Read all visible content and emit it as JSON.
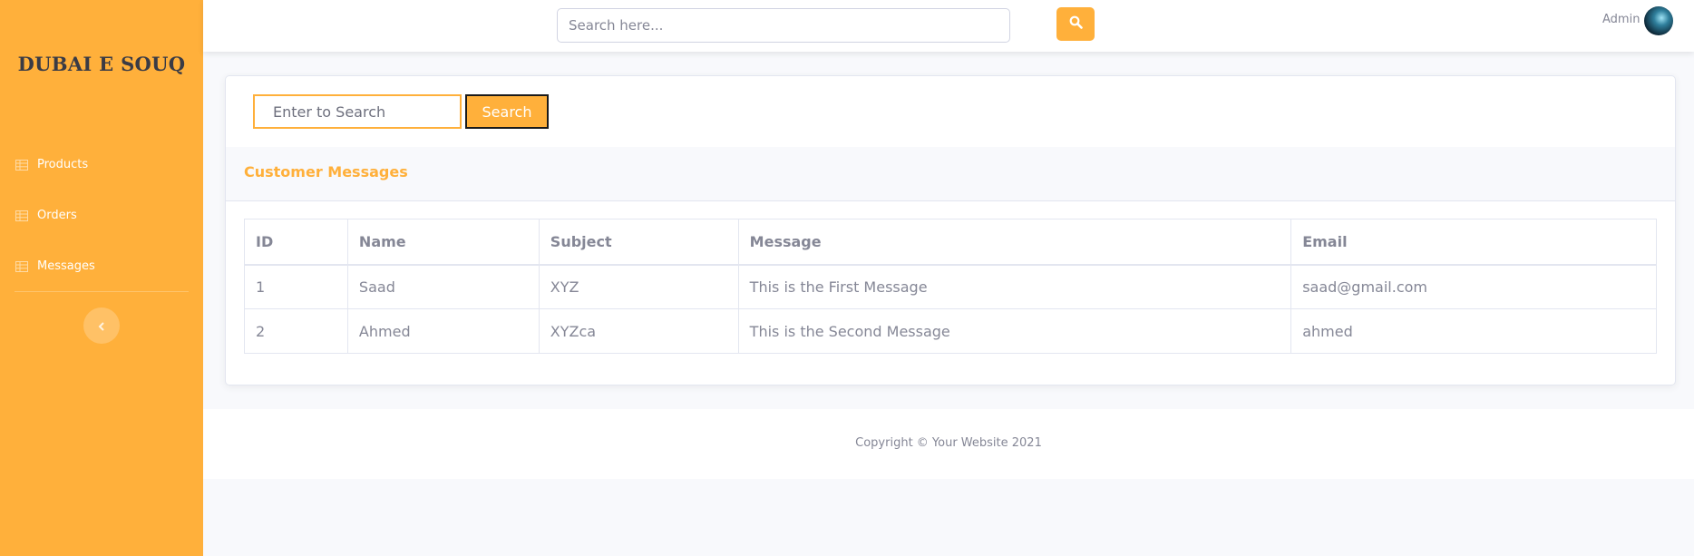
{
  "sidebar": {
    "brand": "DUBAI E SOUQ",
    "items": [
      {
        "label": "Products",
        "icon": "table-icon"
      },
      {
        "label": "Orders",
        "icon": "table-icon"
      },
      {
        "label": "Messages",
        "icon": "table-icon"
      }
    ],
    "toggle_icon": "chevron-left-icon"
  },
  "topbar": {
    "search_placeholder": "Search here...",
    "search_icon": "search-icon",
    "user_name": "Admin"
  },
  "main": {
    "search_placeholder": "Enter to Search",
    "search_button": "Search",
    "card_title": "Customer Messages",
    "table": {
      "headers": [
        "ID",
        "Name",
        "Subject",
        "Message",
        "Email"
      ],
      "rows": [
        [
          "1",
          "Saad",
          "XYZ",
          "This is the First Message",
          "saad@gmail.com"
        ],
        [
          "2",
          "Ahmed",
          "XYZca",
          "This is the Second Message",
          "ahmed"
        ]
      ]
    }
  },
  "footer": {
    "copyright": "Copyright © Your Website 2021"
  },
  "colors": {
    "accent": "#ffb03b",
    "text": "#858796",
    "brand_text": "#3a3b45"
  }
}
